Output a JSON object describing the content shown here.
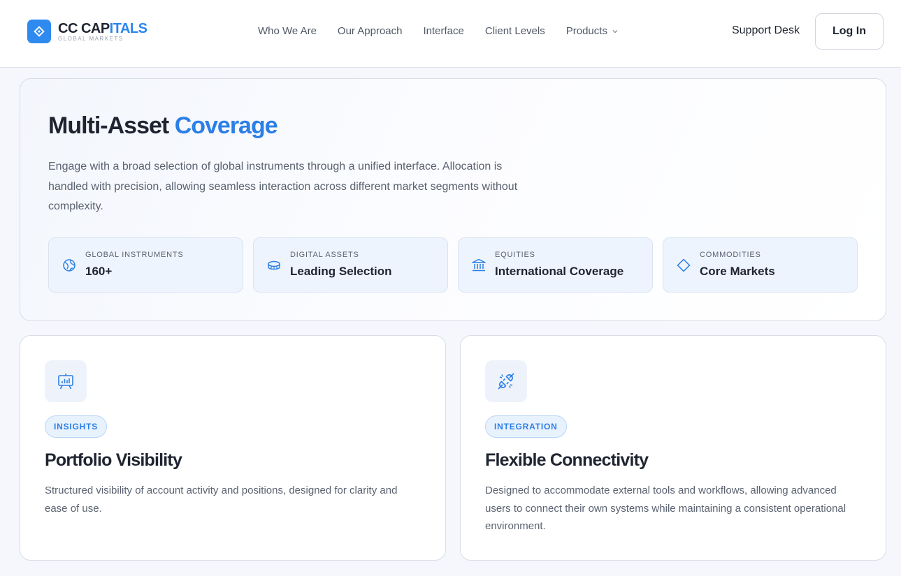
{
  "header": {
    "brand": {
      "name_part1": "CC CAP",
      "name_part2": "ITALS",
      "tagline": "GLOBAL MARKETS",
      "icon": "diamond-logo-icon"
    },
    "nav": [
      {
        "label": "Who We Are"
      },
      {
        "label": "Our Approach"
      },
      {
        "label": "Interface"
      },
      {
        "label": "Client Levels"
      },
      {
        "label": "Products",
        "icon": "chevron-down-icon"
      }
    ],
    "support_label": "Support Desk",
    "login_label": "Log In"
  },
  "coverage": {
    "title_part1": "Multi-Asset ",
    "title_part2": "Coverage",
    "description": "Engage with a broad selection of global instruments through a unified interface. Allocation is handled with precision, allowing seamless interaction across different market segments without complexity.",
    "stats": [
      {
        "label": "GLOBAL INSTRUMENTS",
        "value": "160+",
        "icon": "globe-icon"
      },
      {
        "label": "DIGITAL ASSETS",
        "value": "Leading Selection",
        "icon": "coin-icon"
      },
      {
        "label": "EQUITIES",
        "value": "International Coverage",
        "icon": "bank-icon"
      },
      {
        "label": "COMMODITIES",
        "value": "Core Markets",
        "icon": "diamond-icon"
      }
    ]
  },
  "cards": [
    {
      "badge": "INSIGHTS",
      "title": "Portfolio Visibility",
      "description": "Structured visibility of account activity and positions, designed for clarity and ease of use.",
      "icon": "presentation-chart-icon"
    },
    {
      "badge": "INTEGRATION",
      "title": "Flexible Connectivity",
      "description": "Designed to accommodate external tools and workflows, allowing advanced users to connect their own systems while maintaining a consistent operational environment.",
      "icon": "plug-connection-icon"
    }
  ],
  "colors": {
    "accent": "#2b86ee",
    "text": "#1f2430",
    "muted": "#5a6270",
    "stat_bg": "#eef4fd"
  }
}
